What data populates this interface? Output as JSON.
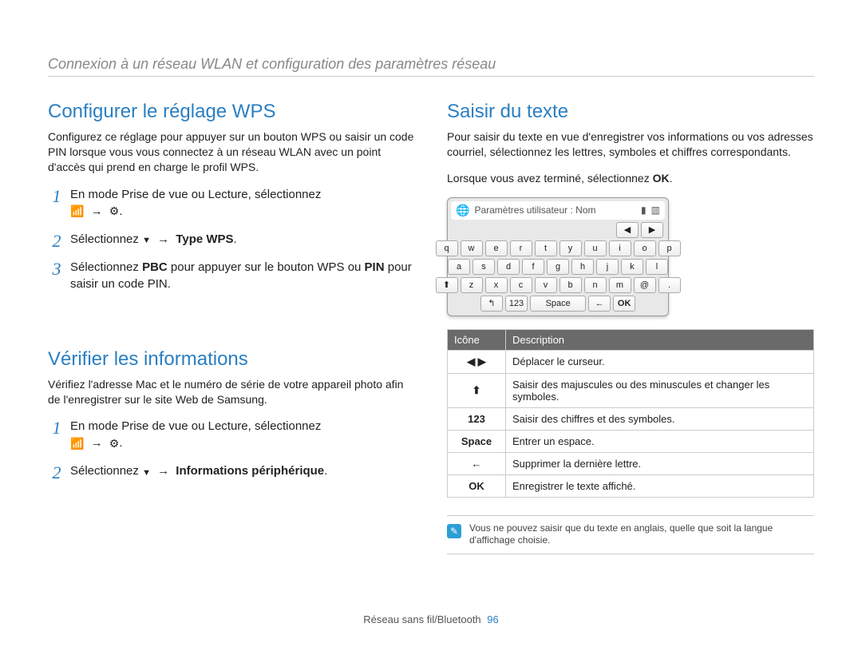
{
  "breadcrumb": "Connexion à un réseau WLAN et configuration des paramètres réseau",
  "left": {
    "section1": {
      "heading": "Configurer le réglage WPS",
      "para": "Configurez ce réglage pour appuyer sur un bouton WPS ou saisir un code PIN lorsque vous vous connectez à un réseau WLAN avec un point d'accès qui prend en charge le profil WPS.",
      "step1": "En mode Prise de vue ou Lecture, sélectionnez",
      "step2_pre": "Sélectionnez ",
      "step2_suf": "Type WPS",
      "step3_a": "Sélectionnez ",
      "step3_pbc": "PBC",
      "step3_b": " pour appuyer sur le bouton WPS ou ",
      "step3_pin": "PIN",
      "step3_c": " pour saisir un code PIN."
    },
    "section2": {
      "heading": "Vérifier les informations",
      "para": "Vérifiez l'adresse Mac et le numéro de série de votre appareil photo afin de l'enregistrer sur le site Web de Samsung.",
      "step1": "En mode Prise de vue ou Lecture, sélectionnez",
      "step2_pre": "Sélectionnez ",
      "step2_suf": "Informations périphérique"
    }
  },
  "right": {
    "heading": "Saisir du texte",
    "para1": "Pour saisir du texte en vue d'enregistrer vos informations ou vos adresses courriel, sélectionnez les lettres, symboles et chiffres correspondants.",
    "para2_a": "Lorsque vous avez terminé, sélectionnez ",
    "para2_ok": "OK",
    "kbd_title": "Paramètres utilisateur : Nom",
    "kbd": {
      "row1": [
        "q",
        "w",
        "e",
        "r",
        "t",
        "y",
        "u",
        "i",
        "o",
        "p"
      ],
      "row2": [
        "a",
        "s",
        "d",
        "f",
        "g",
        "h",
        "j",
        "k",
        "l"
      ],
      "row3": [
        "⬆",
        "z",
        "x",
        "c",
        "v",
        "b",
        "n",
        "m",
        "@",
        "."
      ],
      "row4": [
        "↰",
        "123",
        "Space",
        "←",
        "OK"
      ]
    },
    "table": {
      "h1": "Icône",
      "h2": "Description",
      "rows": [
        {
          "icon": "◀  ▶",
          "desc": "Déplacer le curseur."
        },
        {
          "icon": "⬆",
          "desc": "Saisir des majuscules ou des minuscules et changer les symboles."
        },
        {
          "icon": "123",
          "desc": "Saisir des chiffres et des symboles."
        },
        {
          "icon": "Space",
          "desc": "Entrer un espace."
        },
        {
          "icon": "←",
          "desc": "Supprimer la dernière lettre."
        },
        {
          "icon": "OK",
          "desc": "Enregistrer le texte affiché."
        }
      ]
    },
    "note": "Vous ne pouvez saisir que du texte en anglais, quelle que soit la langue d'affichage choisie."
  },
  "footer": {
    "text": "Réseau sans fil/Bluetooth",
    "page": "96"
  }
}
